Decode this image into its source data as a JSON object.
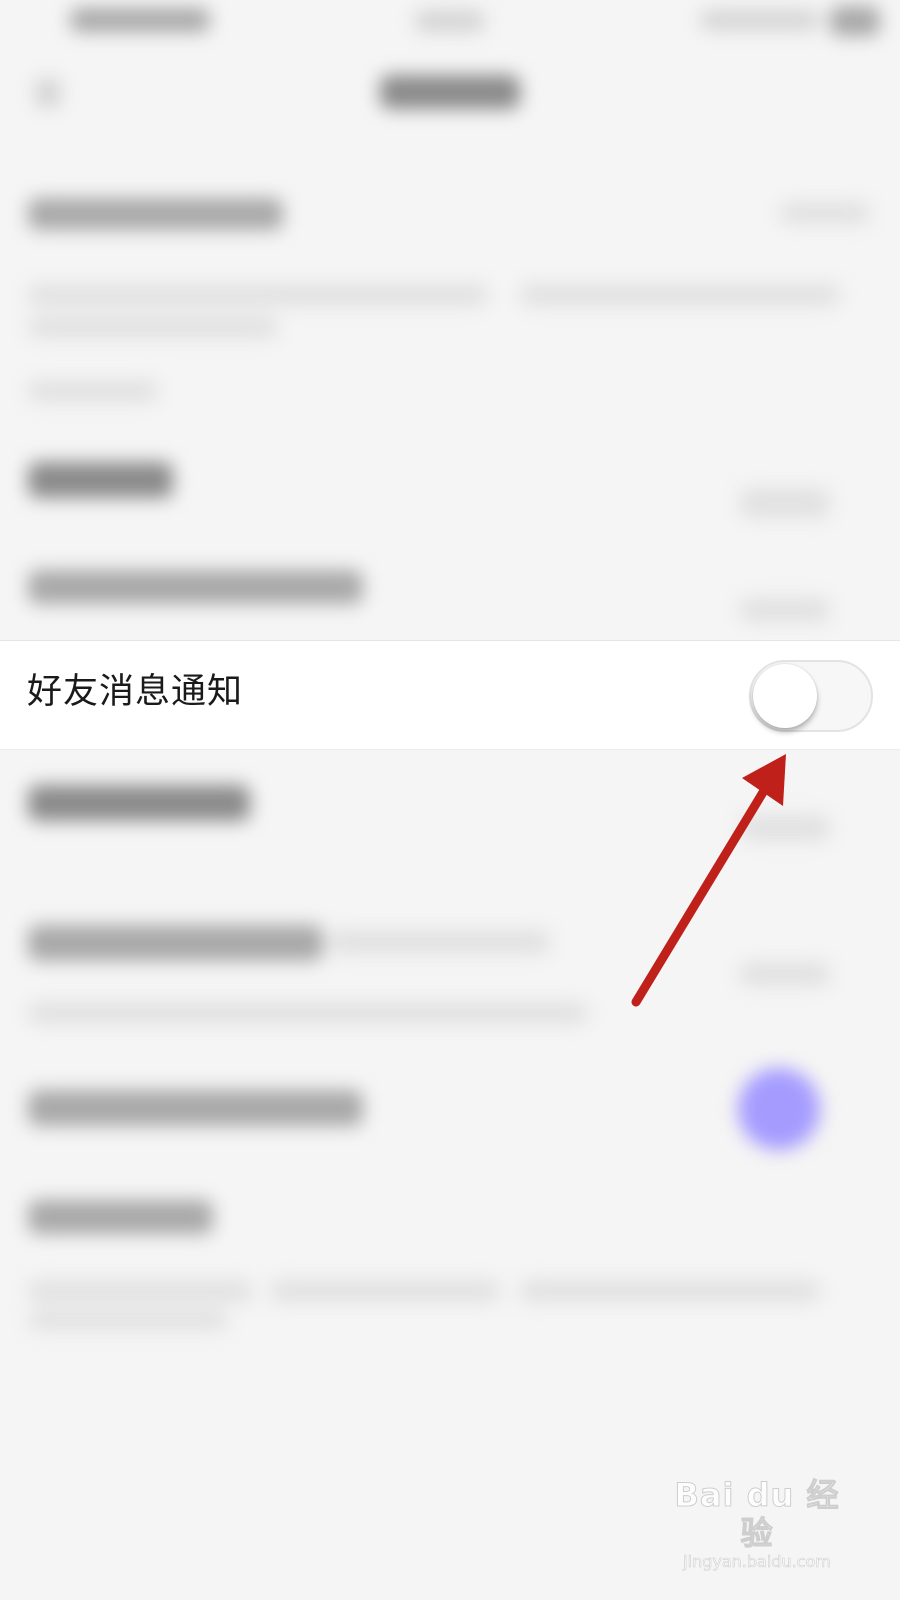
{
  "settings_row": {
    "label": "好友消息通知",
    "toggle_on": false
  },
  "colors": {
    "annotation_arrow": "#c0201a",
    "toggle_knob": "#ffffff",
    "toggle_track_off": "#f7f7f7",
    "background": "#f5f5f5"
  },
  "watermark": {
    "logo_text": "Bai du 经验",
    "url": "jingyan.baidu.com"
  }
}
